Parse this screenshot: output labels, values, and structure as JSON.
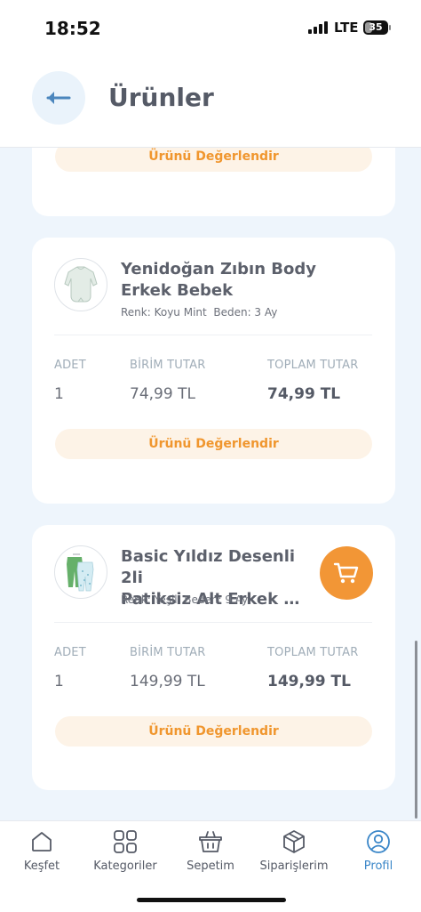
{
  "status_bar": {
    "time": "18:52",
    "network": "LTE",
    "battery": "35",
    "battery_level": 0.35
  },
  "header": {
    "title": "Ürünler"
  },
  "rate_label": "Ürünü Değerlendir",
  "columns": {
    "qty": "ADET",
    "unit_price": "BİRİM TUTAR",
    "total": "TOPLAM TUTAR"
  },
  "products": [
    {
      "name_line1": "Yenidoğan Zıbın Body",
      "name_line2": "Erkek Bebek",
      "meta": "Renk: Koyu Mint  Beden: 3 Ay",
      "qty": "1",
      "unit_price": "74,99 TL",
      "total": "74,99 TL"
    },
    {
      "name_line1": "Basic Yıldız Desenli 2li",
      "name_line2": "Patiksiz Alt Erkek Bebek",
      "meta": "Renk: Yeşil  Beden: 9 Ay",
      "qty": "1",
      "unit_price": "149,99 TL",
      "total": "149,99 TL"
    }
  ],
  "tabs": [
    {
      "label": "Keşfet",
      "icon": "home-icon"
    },
    {
      "label": "Kategoriler",
      "icon": "grid-icon"
    },
    {
      "label": "Sepetim",
      "icon": "basket-icon"
    },
    {
      "label": "Siparişlerim",
      "icon": "box-icon"
    },
    {
      "label": "Profil",
      "icon": "user-icon",
      "active": true
    }
  ],
  "colors": {
    "accent": "#f29636",
    "active_tab": "#3a86c8",
    "background": "#eef5fc"
  }
}
